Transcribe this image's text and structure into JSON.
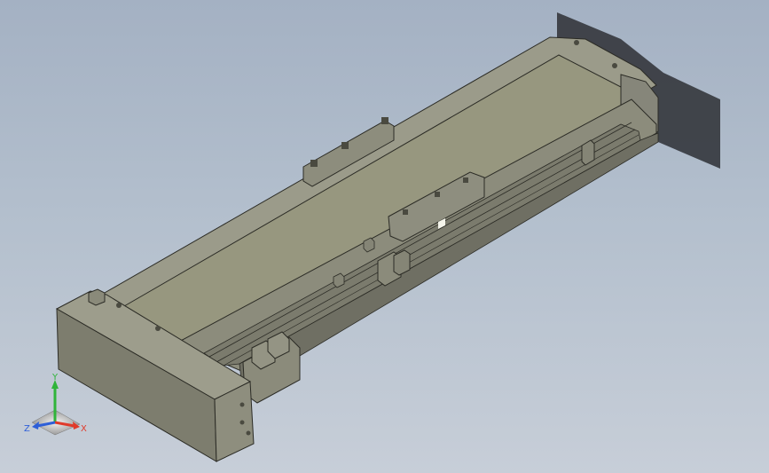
{
  "viewport": {
    "background_top": "#a4b1c3",
    "background_bottom": "#c7ced8"
  },
  "model": {
    "body_color": "#8f8f80",
    "body_top_color": "#9b9b8a",
    "shadow_color": "#3a3d43",
    "edge_color": "#2b2b25"
  },
  "triad": {
    "x_label": "X",
    "y_label": "Y",
    "z_label": "Z",
    "x_color": "#e03a2a",
    "y_color": "#2fb43a",
    "z_color": "#2e5fd8"
  }
}
